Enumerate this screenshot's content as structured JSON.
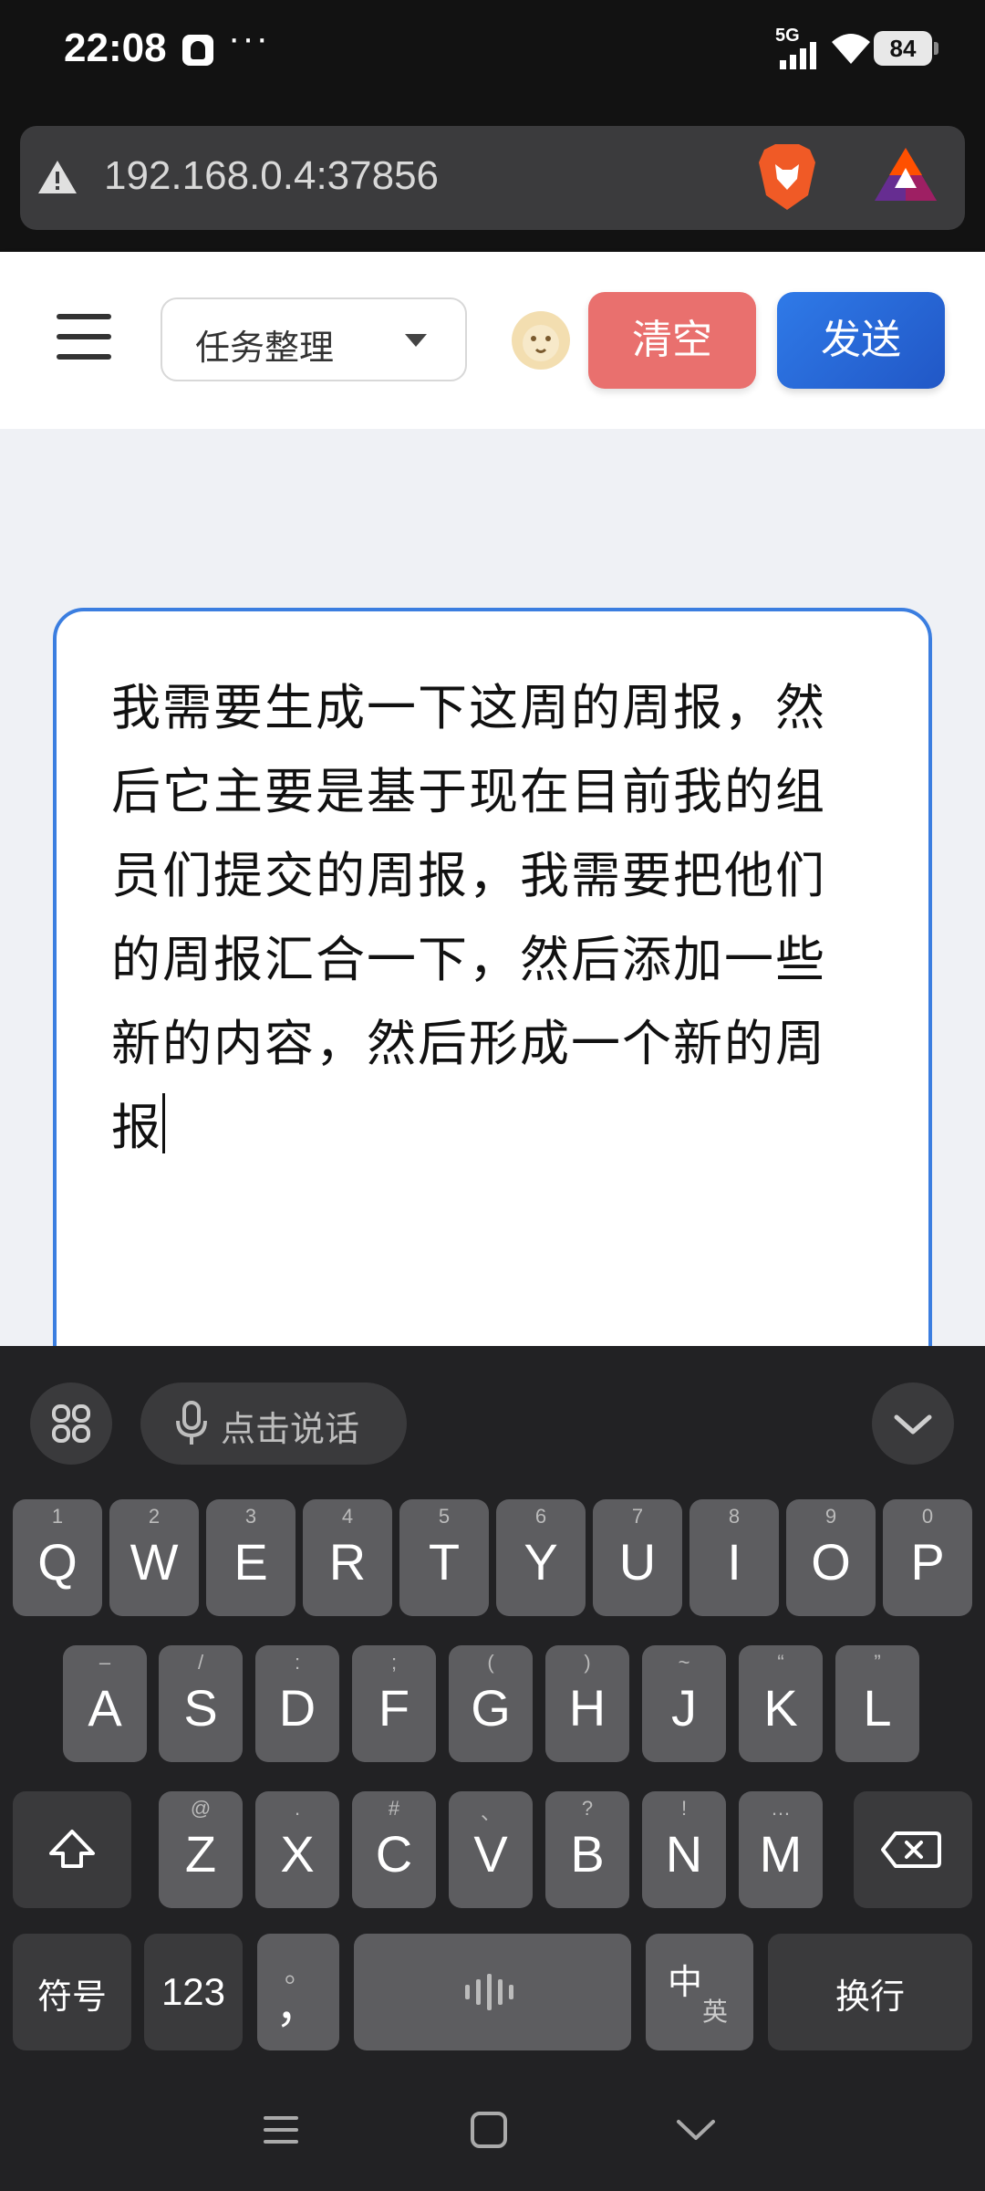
{
  "status_bar": {
    "time": "22:08",
    "dots": "···",
    "network": "5G",
    "battery": "84"
  },
  "browser": {
    "url": "192.168.0.4:37856"
  },
  "app_header": {
    "mode_select": "任务整理",
    "clear_label": "清空",
    "send_label": "发送"
  },
  "editor": {
    "text": "我需要生成一下这周的周报，然后它主要是基于现在目前我的组员们提交的周报，我需要把他们的周报汇合一下，然后添加一些新的内容，然后形成一个新的周报"
  },
  "keyboard": {
    "voice_label": "点击说话",
    "row1": [
      {
        "k": "Q",
        "s": "1"
      },
      {
        "k": "W",
        "s": "2"
      },
      {
        "k": "E",
        "s": "3"
      },
      {
        "k": "R",
        "s": "4"
      },
      {
        "k": "T",
        "s": "5"
      },
      {
        "k": "Y",
        "s": "6"
      },
      {
        "k": "U",
        "s": "7"
      },
      {
        "k": "I",
        "s": "8"
      },
      {
        "k": "O",
        "s": "9"
      },
      {
        "k": "P",
        "s": "0"
      }
    ],
    "row2": [
      {
        "k": "A",
        "s": "–"
      },
      {
        "k": "S",
        "s": "/"
      },
      {
        "k": "D",
        "s": ":"
      },
      {
        "k": "F",
        "s": ";"
      },
      {
        "k": "G",
        "s": "("
      },
      {
        "k": "H",
        "s": ")"
      },
      {
        "k": "J",
        "s": "~"
      },
      {
        "k": "K",
        "s": "“"
      },
      {
        "k": "L",
        "s": "”"
      }
    ],
    "row3": [
      {
        "k": "Z",
        "s": "@"
      },
      {
        "k": "X",
        "s": "."
      },
      {
        "k": "C",
        "s": "#"
      },
      {
        "k": "V",
        "s": "、"
      },
      {
        "k": "B",
        "s": "?"
      },
      {
        "k": "N",
        "s": "!"
      },
      {
        "k": "M",
        "s": "…"
      }
    ],
    "symbols_label": "符号",
    "numbers_label": "123",
    "comma_main": "，",
    "comma_sub": "。",
    "lang_main": "中",
    "lang_sub": "英",
    "enter_label": "换行"
  }
}
